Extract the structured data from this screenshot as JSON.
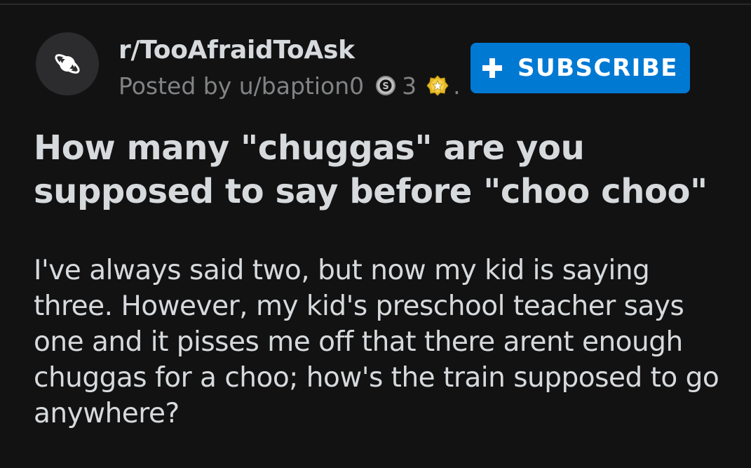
{
  "post": {
    "subreddit": "r/TooAfraidToAsk",
    "posted_by": "Posted by u/baption0",
    "awards": {
      "silver_icon": "silver-award-icon",
      "count": "3",
      "gold_icon": "gold-award-icon"
    },
    "separator": ".",
    "title": "How many \"chuggas\" are you supposed to say before \"choo choo\"",
    "body": "I've always said two, but now my kid is saying three. However, my kid's preschool teacher says one and it pisses me off that there arent enough chuggas for a choo; how's the train supposed to go anywhere?"
  },
  "subscribe_button": {
    "icon": "plus-icon",
    "label": "SUBSCRIBE"
  },
  "subreddit_icon": "planet-icon",
  "colors": {
    "background": "#121213",
    "text": "#d7dadc",
    "muted": "#818384",
    "accent": "#0079d3"
  }
}
